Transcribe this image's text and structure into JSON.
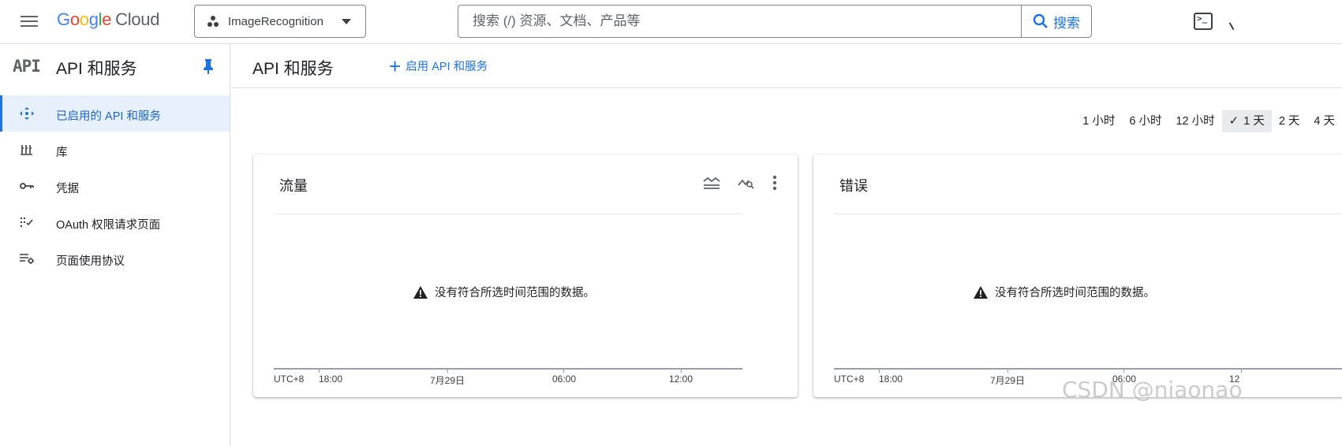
{
  "header": {
    "logo_google": "Google",
    "logo_cloud": "Cloud",
    "project_name": "ImageRecognition",
    "search_placeholder": "搜索 (/) 资源、文档、产品等",
    "search_button": "搜索"
  },
  "sidebar": {
    "logo": "API",
    "title": "API 和服务",
    "items": [
      {
        "label": "已启用的 API 和服务",
        "icon": "api-dots-icon",
        "active": true
      },
      {
        "label": "库",
        "icon": "library-icon",
        "active": false
      },
      {
        "label": "凭据",
        "icon": "key-icon",
        "active": false
      },
      {
        "label": "OAuth 权限请求页面",
        "icon": "oauth-consent-icon",
        "active": false
      },
      {
        "label": "页面使用协议",
        "icon": "page-agreement-icon",
        "active": false
      }
    ]
  },
  "main": {
    "title": "API 和服务",
    "enable_button": "启用 API 和服务",
    "time_ranges": [
      "1 小时",
      "6 小时",
      "12 小时",
      "1 天",
      "2 天",
      "4 天"
    ],
    "selected_time_range": "1 天",
    "cards": [
      {
        "title": "流量",
        "no_data": "没有符合所选时间范围的数据。",
        "axis_labels": [
          "UTC+8",
          "18:00",
          "7月29日",
          "06:00",
          "12:00"
        ]
      },
      {
        "title": "错误",
        "no_data": "没有符合所选时间范围的数据。",
        "axis_labels": [
          "UTC+8",
          "18:00",
          "7月29日",
          "06:00",
          "12"
        ]
      }
    ]
  },
  "colors": {
    "accent": "#1a73e8",
    "active_bg": "#e8f0fe",
    "border": "#dadce0"
  },
  "watermark": "CSDN @niaonao"
}
